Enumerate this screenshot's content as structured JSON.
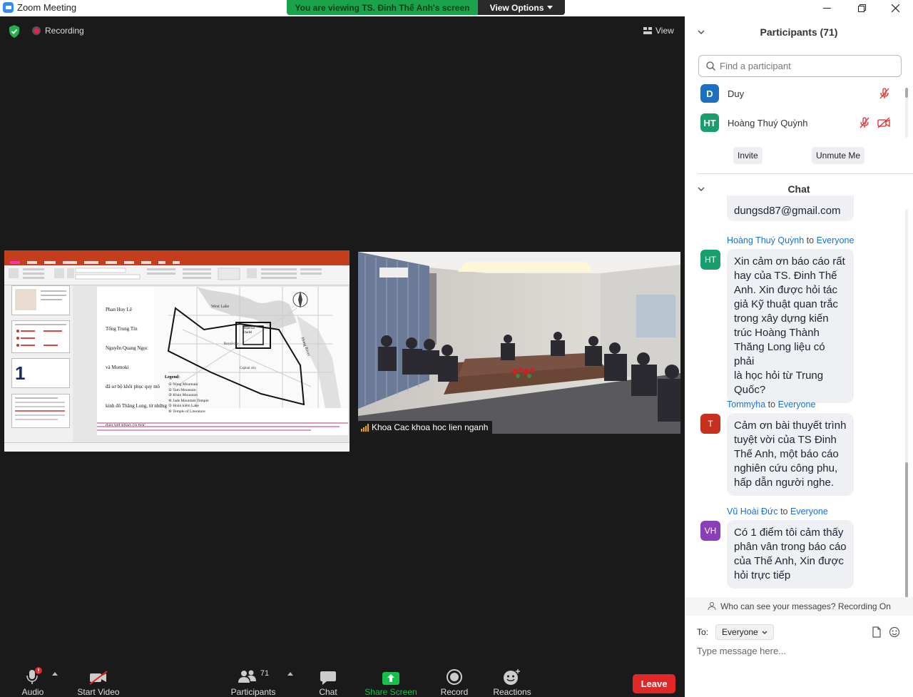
{
  "window": {
    "title": "Zoom Meeting",
    "minimize": "—",
    "maximize": "❐",
    "close": "✕"
  },
  "banner": {
    "text": "You are viewing TS. Đinh Thế Anh's screen",
    "options_label": "View Options"
  },
  "status": {
    "recording_label": "Recording",
    "view_label": "View"
  },
  "shared_slide": {
    "lines": [
      "Phan Huy Lê",
      "Tống Trung Tín",
      "Nguyễn Quang Ngọc",
      "và Momoki",
      "đã sơ bộ khôi phục quy mô",
      "kinh đô Thăng Long, từ những",
      "dấu vết khảo cổ học"
    ],
    "legend_title": "Legend:",
    "legend": [
      "① Nùng Mountain",
      "② Tam Mountain",
      "③ Khán Mountain",
      "④ Jade Mountain Temple",
      "⑤ Hoàn kiếm Lake",
      "⑥ Temple of Literature"
    ],
    "map_labels": {
      "west_lake": "West Lake",
      "imperial": "Imperial citadel",
      "capital": "Capital city",
      "river": "Hong River",
      "royal": "Royal city"
    },
    "thumb_number": "1"
  },
  "video_tile": {
    "name": "Khoa Cac khoa hoc lien nganh"
  },
  "toolbar": {
    "audio": "Audio",
    "video": "Start Video",
    "participants": "Participants",
    "participants_count": "71",
    "chat": "Chat",
    "share": "Share Screen",
    "record": "Record",
    "reactions": "Reactions",
    "leave": "Leave"
  },
  "colors": {
    "share_green": "#17c04a",
    "leave_red": "#e02828",
    "link_blue": "#1a6fd6"
  },
  "participants_panel": {
    "title": "Participants (71)",
    "search_placeholder": "Find a participant",
    "list": [
      {
        "initials": "D",
        "name": "Duy",
        "color": "#1f6fbf"
      },
      {
        "initials": "HT",
        "name": "Hoàng Thuý Quỳnh",
        "color": "#1a9e6e"
      }
    ],
    "invite": "Invite",
    "unmute_me": "Unmute Me"
  },
  "chat_panel": {
    "title": "Chat",
    "partial_message": "dungsd87@gmail.com",
    "messages": [
      {
        "sender": "Hoàng Thuý Quỳnh",
        "to_word": "to",
        "recipient": "Everyone",
        "initials": "HT",
        "color": "#1a9e6e",
        "lines": [
          "Xin cảm ơn báo cáo rất",
          "hay của TS. Đinh Thế",
          "Anh. Xin được hỏi tác",
          "giả Kỹ thuật quan trắc",
          "trong xây dựng kiến",
          "trúc Hoàng Thành",
          "Thăng Long liệu có phải",
          "là học hỏi từ Trung",
          "Quốc?"
        ]
      },
      {
        "sender": "Tommyha",
        "to_word": "to",
        "recipient": "Everyone",
        "initials": "T",
        "color": "#c8301e",
        "lines": [
          "Cảm ơn bài thuyết trình",
          "tuyệt vời của TS Đinh",
          "Thế Anh, một báo cáo",
          "nghiên cứu công phu,",
          "hấp dẫn người nghe."
        ]
      },
      {
        "sender": "Vũ Hoài Đức",
        "to_word": "to",
        "recipient": "Everyone",
        "initials": "VH",
        "color": "#8a3fb8",
        "lines": [
          "Có 1 điểm tôi cảm thấy",
          "phân vân trong báo cáo",
          "của Thế Anh, Xin được",
          "hỏi trực tiếp"
        ]
      }
    ],
    "privacy_note": "Who can see your messages? Recording On",
    "to_label": "To:",
    "to_value": "Everyone",
    "input_placeholder": "Type message here..."
  }
}
